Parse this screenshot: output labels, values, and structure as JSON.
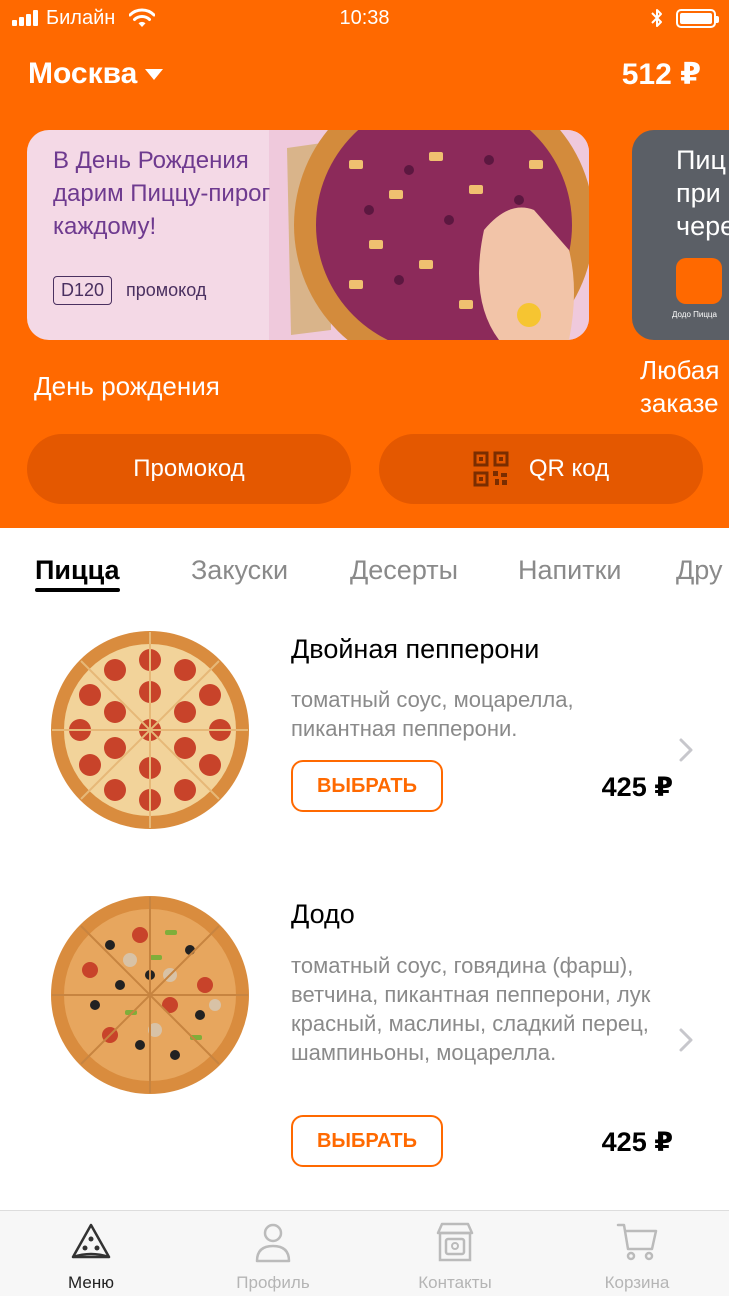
{
  "status_bar": {
    "carrier": "Билайн",
    "time": "10:38"
  },
  "header": {
    "city": "Москва",
    "balance": "512 ₽"
  },
  "banners": [
    {
      "title": "В День Рождения дарим Пиццу-пирог каждому!",
      "promo_code": "D120",
      "promo_label": "промокод",
      "caption": "День рождения"
    },
    {
      "title": "Пиц\nпри\nчере",
      "logo_text": "Додо Пицца",
      "caption": "Любая\nзаказе"
    }
  ],
  "actions": {
    "promo_label": "Промокод",
    "qr_label": "QR код"
  },
  "categories": [
    {
      "label": "Пицца",
      "active": true
    },
    {
      "label": "Закуски",
      "active": false
    },
    {
      "label": "Десерты",
      "active": false
    },
    {
      "label": "Напитки",
      "active": false
    },
    {
      "label": "Дру",
      "active": false
    }
  ],
  "products": [
    {
      "name": "Двойная пепперони",
      "description": "томатный соус, моцарелла, пикантная пепперони.",
      "button": "ВЫБРАТЬ",
      "price": "425 ₽"
    },
    {
      "name": "Додо",
      "description": "томатный соус, говядина (фарш), ветчина, пикантная пепперони, лук красный, маслины, сладкий перец, шампиньоны, моцарелла.",
      "button": "ВЫБРАТЬ",
      "price": "425 ₽"
    }
  ],
  "tabbar": [
    {
      "label": "Меню",
      "icon": "pizza-slice-icon",
      "active": true
    },
    {
      "label": "Профиль",
      "icon": "person-icon",
      "active": false
    },
    {
      "label": "Контакты",
      "icon": "store-icon",
      "active": false
    },
    {
      "label": "Корзина",
      "icon": "cart-icon",
      "active": false
    }
  ],
  "colors": {
    "brand": "#FF6900",
    "brand_dark": "#E45800",
    "muted_text": "#8a8a8a"
  }
}
